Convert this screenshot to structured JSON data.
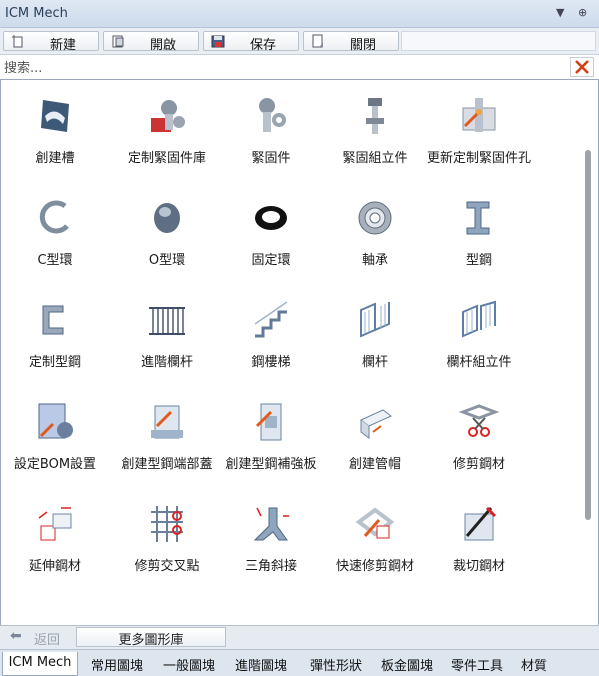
{
  "window": {
    "title": "ICM Mech",
    "pin_glyph": "▼",
    "dock_glyph": "⊕"
  },
  "toolbar": {
    "buttons": [
      {
        "label": "新建",
        "icon": "new-icon"
      },
      {
        "label": "開啟",
        "icon": "open-icon"
      },
      {
        "label": "保存",
        "icon": "save-icon"
      },
      {
        "label": "關閉",
        "icon": "close-file-icon"
      }
    ]
  },
  "search": {
    "placeholder": "搜索...",
    "value": ""
  },
  "gallery": {
    "items": [
      {
        "label": "創建槽",
        "icon": "slot-icon"
      },
      {
        "label": "定制緊固件庫",
        "icon": "custom-fastener-library-icon"
      },
      {
        "label": "緊固件",
        "icon": "fastener-icon"
      },
      {
        "label": "緊固組立件",
        "icon": "fastener-assembly-icon"
      },
      {
        "label": "更新定制緊固件孔",
        "icon": "update-fastener-hole-icon"
      },
      {
        "label": "C型環",
        "icon": "c-ring-icon"
      },
      {
        "label": "O型環",
        "icon": "o-ring-icon"
      },
      {
        "label": "固定環",
        "icon": "retaining-ring-icon"
      },
      {
        "label": "軸承",
        "icon": "bearing-icon"
      },
      {
        "label": "型鋼",
        "icon": "steel-section-icon"
      },
      {
        "label": "定制型鋼",
        "icon": "custom-steel-section-icon"
      },
      {
        "label": "進階欄杆",
        "icon": "advanced-railing-icon"
      },
      {
        "label": "鋼樓梯",
        "icon": "steel-stair-icon"
      },
      {
        "label": "欄杆",
        "icon": "railing-icon"
      },
      {
        "label": "欄杆組立件",
        "icon": "railing-assembly-icon"
      },
      {
        "label": "設定BOM設置",
        "icon": "bom-settings-icon"
      },
      {
        "label": "創建型鋼端部蓋",
        "icon": "steel-end-cap-icon"
      },
      {
        "label": "創建型鋼補強板",
        "icon": "steel-stiffener-icon"
      },
      {
        "label": "創建管帽",
        "icon": "pipe-cap-icon"
      },
      {
        "label": "修剪鋼材",
        "icon": "trim-steel-icon"
      },
      {
        "label": "延伸鋼材",
        "icon": "extend-steel-icon"
      },
      {
        "label": "修剪交叉點",
        "icon": "trim-intersection-icon"
      },
      {
        "label": "三角斜接",
        "icon": "miter-joint-icon"
      },
      {
        "label": "快速修剪鋼材",
        "icon": "quick-trim-steel-icon"
      },
      {
        "label": "裁切鋼材",
        "icon": "cut-steel-icon"
      },
      {
        "label": "",
        "icon": "partial-icon-1"
      },
      {
        "label": "",
        "icon": "partial-icon-2"
      },
      {
        "label": "",
        "icon": "partial-delete-icon"
      },
      {
        "label": "",
        "icon": "partial-icon-4"
      },
      {
        "label": "",
        "icon": "partial-gear-icon"
      }
    ]
  },
  "bottom": {
    "back_label": "返回",
    "more_label": "更多圖形庫"
  },
  "tabs": [
    {
      "label": "ICM Mech",
      "active": true
    },
    {
      "label": "常用圖塊",
      "active": false
    },
    {
      "label": "一般圖塊",
      "active": false
    },
    {
      "label": "進階圖塊",
      "active": false
    },
    {
      "label": "彈性形狀",
      "active": false
    },
    {
      "label": "板金圖塊",
      "active": false
    },
    {
      "label": "零件工具",
      "active": false
    },
    {
      "label": "材質",
      "active": false
    }
  ],
  "colors": {
    "accent": "#e05a1e",
    "metal": "#8a95a3",
    "steel_blue": "#6f8fb5",
    "red": "#d22"
  }
}
